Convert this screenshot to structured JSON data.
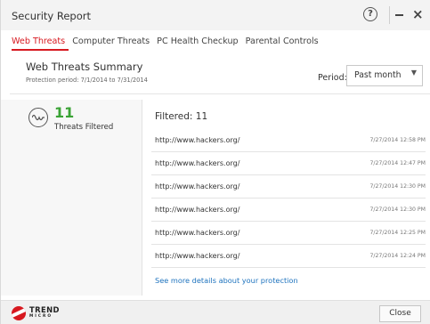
{
  "window": {
    "title": "Security Report",
    "help_label": "?",
    "close_glyph": "×"
  },
  "tabs": [
    {
      "label": "Web Threats",
      "active": true
    },
    {
      "label": "Computer Threats",
      "active": false
    },
    {
      "label": "PC Health Checkup",
      "active": false
    },
    {
      "label": "Parental Controls",
      "active": false
    }
  ],
  "summary": {
    "title": "Web Threats Summary",
    "protection_period": "Protection period: 7/1/2014 to 7/31/2014",
    "period_label": "Period:",
    "period_value": "Past month"
  },
  "stats": {
    "count": "11",
    "label": "Threats Filtered",
    "icon": "pulse-icon",
    "count_color": "#3aa335"
  },
  "list": {
    "heading": "Filtered: 11",
    "rows": [
      {
        "url": "http://www.hackers.org/",
        "time": "7/27/2014 12:58 PM"
      },
      {
        "url": "http://www.hackers.org/",
        "time": "7/27/2014 12:47 PM"
      },
      {
        "url": "http://www.hackers.org/",
        "time": "7/27/2014 12:30 PM"
      },
      {
        "url": "http://www.hackers.org/",
        "time": "7/27/2014 12:30 PM"
      },
      {
        "url": "http://www.hackers.org/",
        "time": "7/27/2014 12:25 PM"
      },
      {
        "url": "http://www.hackers.org/",
        "time": "7/27/2014 12:24 PM"
      }
    ],
    "more_link": "See more details about your protection"
  },
  "footer": {
    "logo_line1": "TREND",
    "logo_line2": "MICRO",
    "close_button": "Close"
  },
  "colors": {
    "accent": "#d71920",
    "link": "#1e73be"
  }
}
